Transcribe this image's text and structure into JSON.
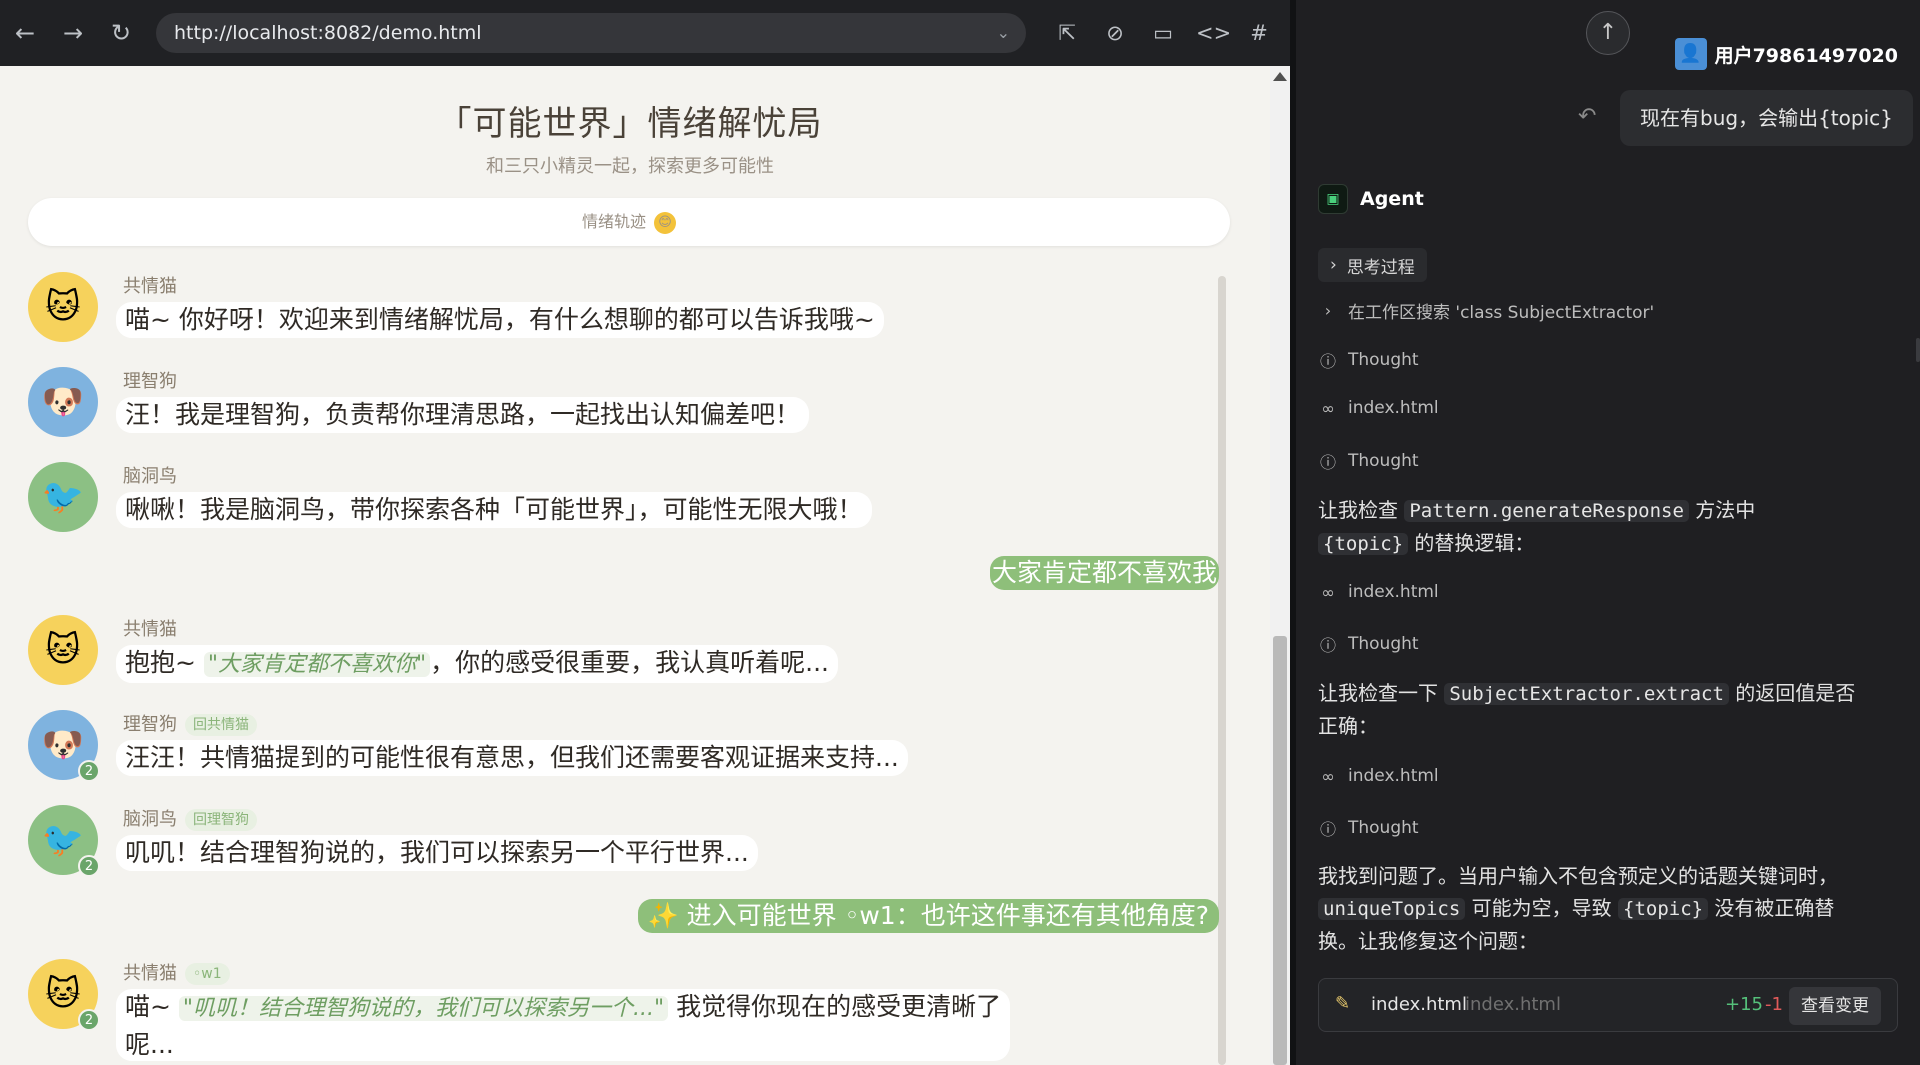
{
  "browser": {
    "url": "http://localhost:8082/demo.html",
    "icons": {
      "back": "←",
      "forward": "→",
      "reload": "↻",
      "dropdown": "⌄",
      "pick": "⇱",
      "compass": "⊘",
      "device": "▭",
      "code": "<>",
      "hash": "#"
    }
  },
  "page": {
    "title": "「可能世界」情绪解忧局",
    "subtitle": "和三只小精灵一起，探索更多可能性",
    "mood_label": "情绪轨迹",
    "mood_emoji": "😊"
  },
  "messages": [
    {
      "speaker": "共情猫",
      "avatar": "🐱",
      "text": "喵~ 你好呀！欢迎来到情绪解忧局，有什么想聊的都可以告诉我哦~"
    },
    {
      "speaker": "理智狗",
      "avatar": "🐶",
      "text": "汪！我是理智狗，负责帮你理清思路，一起找出认知偏差吧！"
    },
    {
      "speaker": "脑洞鸟",
      "avatar": "🐦",
      "text": "啾啾！我是脑洞鸟，带你探索各种「可能世界」，可能性无限大哦！"
    },
    {
      "user": "大家肯定都不喜欢我"
    },
    {
      "speaker": "共情猫",
      "avatar": "🐱",
      "pre": "抱抱~ ",
      "quote": "\"大家肯定都不喜欢你\"",
      "post": "，你的感受很重要，我认真听着呢..."
    },
    {
      "speaker": "理智狗",
      "avatar": "🐶",
      "tag": "回共情猫",
      "badge": "2",
      "text": "汪汪！共情猫提到的可能性很有意思，但我们还需要客观证据来支持..."
    },
    {
      "speaker": "脑洞鸟",
      "avatar": "🐦",
      "tag": "回理智狗",
      "badge": "2",
      "text": "叽叽！结合理智狗说的，我们可以探索另一个平行世界..."
    },
    {
      "user": "✨ 进入可能世界 ◦w1：也许这件事还有其他角度?"
    },
    {
      "speaker": "共情猫",
      "avatar": "🐱",
      "tag": "◦w1",
      "badge": "2",
      "pre": "喵~ ",
      "quote": "\"叽叽！结合理智狗说的，我们可以探索另一个...\"",
      "post": " 我觉得你现在的感受更清晰了",
      "line2": "呢..."
    }
  ],
  "panel": {
    "user_name": "用户79861497020",
    "user_query": "现在有bug，会输出{topic}",
    "agent_label": "Agent",
    "think_label": "思考过程",
    "search_step": "在工作区搜索 'class SubjectExtractor'",
    "thought": "Thought",
    "file": "index.html",
    "para1_a": "让我检查 ",
    "para1_code1": "Pattern.generateResponse",
    "para1_b": " 方法中",
    "para1_code2": "{topic}",
    "para1_c": " 的替换逻辑：",
    "para2_a": "让我检查一下 ",
    "para2_code": "SubjectExtractor.extract",
    "para2_b": " 的返回值是否",
    "para2_c": "正确：",
    "para3_a": "我找到问题了。当用户输入不包含预定义的话题关键词时，",
    "para3_code1": "uniqueTopics",
    "para3_b": " 可能为空，导致 ",
    "para3_code2": "{topic}",
    "para3_c": " 没有被正确替",
    "para3_d": "换。让我修复这个问题：",
    "edit": {
      "file": "index.html",
      "path": "index.html",
      "plus": "+15",
      "minus": "-1",
      "button": "查看变更"
    }
  }
}
